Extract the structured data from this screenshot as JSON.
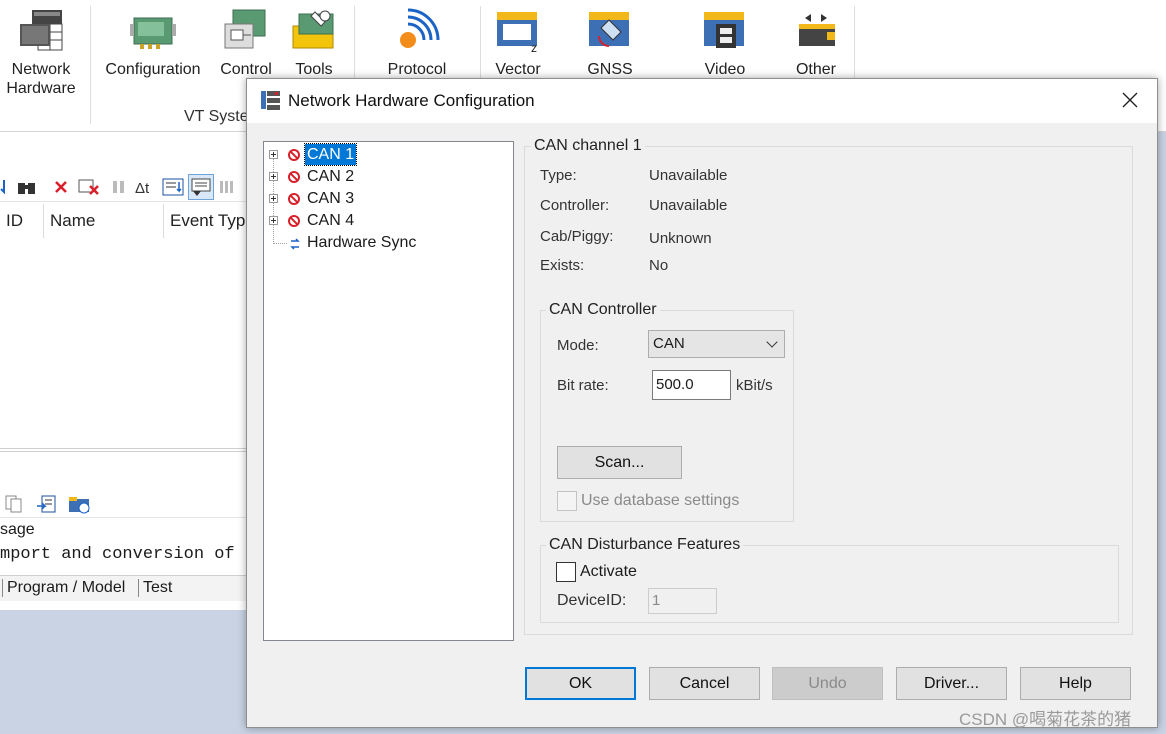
{
  "ribbon": {
    "buttons": [
      {
        "label": "Network\nHardware",
        "icon": "network-hardware-icon"
      },
      {
        "label": "Configuration",
        "icon": "configuration-icon"
      },
      {
        "label": "Control",
        "icon": "control-icon"
      },
      {
        "label": "Tools",
        "icon": "tools-icon"
      },
      {
        "label": "Protocol",
        "icon": "protocol-icon"
      },
      {
        "label": "Vector",
        "icon": "vector-icon"
      },
      {
        "label": "GNSS",
        "icon": "gnss-icon"
      },
      {
        "label": "Video",
        "icon": "video-icon"
      },
      {
        "label": "Other",
        "icon": "other-icon"
      }
    ],
    "group_label": "VT Syste"
  },
  "left_panel": {
    "columns": [
      "ID",
      "Name",
      "Event Typ"
    ],
    "text1": "sage",
    "text2": "mport and conversion of",
    "tabs": [
      "Program / Model",
      "Test"
    ]
  },
  "dialog": {
    "title": "Network Hardware Configuration",
    "tree": [
      {
        "label": "CAN 1",
        "selected": true
      },
      {
        "label": "CAN 2",
        "selected": false
      },
      {
        "label": "CAN 3",
        "selected": false
      },
      {
        "label": "CAN 4",
        "selected": false
      },
      {
        "label": "Hardware Sync",
        "selected": false
      }
    ],
    "channel_group_title": "CAN channel 1",
    "info": [
      {
        "label": "Type:",
        "value": "Unavailable"
      },
      {
        "label": "Controller:",
        "value": "Unavailable"
      },
      {
        "label": "Cab/Piggy:",
        "value": "Unknown"
      },
      {
        "label": "Exists:",
        "value": "No"
      }
    ],
    "controller": {
      "title": "CAN Controller",
      "mode_label": "Mode:",
      "mode_value": "CAN",
      "bitrate_label": "Bit rate:",
      "bitrate_value": "500.0",
      "bitrate_unit": "kBit/s",
      "scan_label": "Scan...",
      "use_db_label": "Use database settings"
    },
    "disturbance": {
      "title": "CAN Disturbance Features",
      "activate_label": "Activate",
      "device_id_label": "DeviceID:",
      "device_id_value": "1"
    },
    "buttons": {
      "ok": "OK",
      "cancel": "Cancel",
      "undo": "Undo",
      "driver": "Driver...",
      "help": "Help"
    }
  },
  "watermark": "CSDN @喝菊花茶的猪"
}
